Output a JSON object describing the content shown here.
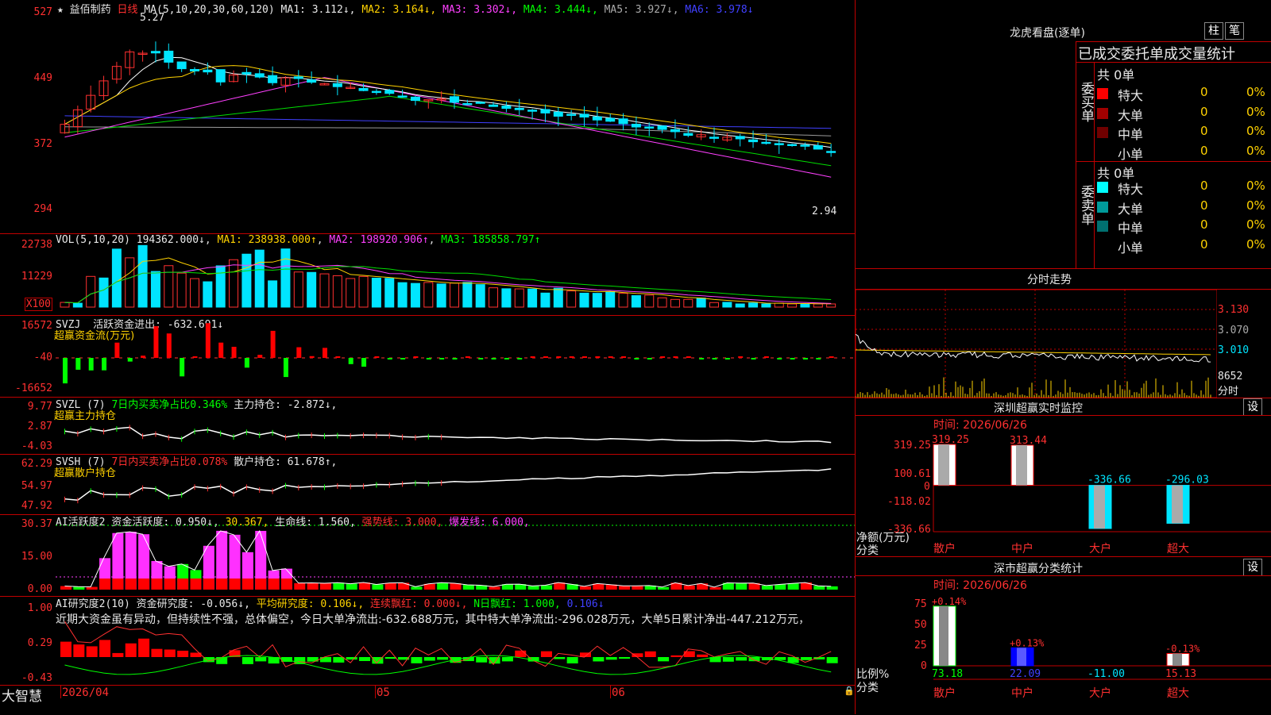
{
  "stock": {
    "name": "益佰制药",
    "period": "日线",
    "brand": "大智慧"
  },
  "colors": {
    "up": "#ff3030",
    "down": "#00e5ff",
    "frame": "#c00000",
    "ma1": "#ffffff",
    "ma2": "#ffd200",
    "ma3": "#ff40ff",
    "ma4": "#00dd00",
    "ma5": "#9a9a9a",
    "ma6": "#4040ff"
  },
  "main_pane": {
    "ma_header": "MA(5,10,20,30,60,120)",
    "ma_values": [
      {
        "label": "MA1:",
        "value": "3.112↓"
      },
      {
        "label": "MA2:",
        "value": "3.164↓"
      },
      {
        "label": "MA3:",
        "value": "3.302↓"
      },
      {
        "label": "MA4:",
        "value": "3.444↓"
      },
      {
        "label": "MA5:",
        "value": "3.927↓"
      },
      {
        "label": "MA6:",
        "value": "3.978↓"
      }
    ],
    "y_ticks": [
      "527",
      "449",
      "372",
      "294"
    ],
    "high_label": "5.27",
    "low_label": "2.94"
  },
  "vol_pane": {
    "header": "VOL(5,10,20)",
    "value": "194362.000↓",
    "ma1": "MA1: 238938.000↑",
    "ma2": "MA2: 198920.906↑",
    "ma3": "MA3: 185858.797↑",
    "y_ticks": [
      "22738",
      "11229",
      "X100"
    ]
  },
  "svzj_pane": {
    "header": "SVZJ",
    "label": "活跃资金进出: -632.691↓",
    "subtitle": "超赢资金流(万元)",
    "y_ticks": [
      "16572",
      "-40",
      "-16652"
    ]
  },
  "svzl_pane": {
    "header": "SVZL (7)",
    "label1": "7日内买卖净占比0.346%",
    "label2": "主力持仓: -2.872↓,",
    "subtitle": "超赢主力持仓",
    "y_ticks": [
      "9.77",
      "2.87",
      "-4.03"
    ]
  },
  "svsh_pane": {
    "header": "SVSH (7)",
    "label1": "7日内买卖净占比0.078%",
    "label2": "散户持仓: 61.678↑,",
    "subtitle": "超赢散户持仓",
    "y_ticks": [
      "62.29",
      "54.97",
      "47.92"
    ]
  },
  "ai1_pane": {
    "header": "AI活跃度2",
    "label1": "资金活跃度: 0.950↓",
    "label2": "30.367,",
    "label3": "生命线: 1.560,",
    "label4": "强势线: 3.000,",
    "label5": "爆发线: 6.000,",
    "y_ticks": [
      "30.37",
      "15.00",
      "0.00"
    ]
  },
  "ai2_pane": {
    "header": "AI研究度2(10)",
    "label1": "资金研究度: -0.056↓,",
    "label2": "平均研究度: 0.106↓,",
    "label3": "连续飘红: 0.000↓,",
    "label4": "N日飘红: 1.000,",
    "label5": "0.106↓",
    "commentary": "近期大资金虽有异动，但持续性不强，总体偏空，今日大单净流出:-632.688万元，其中特大单净流出:-296.028万元，大单5日累计净出-447.212万元，",
    "y_ticks": [
      "1.00",
      "0.29",
      "-0.43"
    ]
  },
  "x_axis": {
    "labels": [
      "2026/04",
      "05",
      "06"
    ]
  },
  "right_panel": {
    "lhb": {
      "title": "龙虎看盘(逐单)",
      "btn_bar": "柱",
      "btn_pen": "笔",
      "table_title": "已成交委托单成交量统计",
      "buy_label": "委买单",
      "sell_label": "委卖单",
      "buy_total": "共 0单",
      "sell_total": "共 0单",
      "buy_rows": [
        {
          "name": "特大",
          "count": "0",
          "pct": "0%",
          "color": "#ff0000"
        },
        {
          "name": "大单",
          "count": "0",
          "pct": "0%",
          "color": "#a00000"
        },
        {
          "name": "中单",
          "count": "0",
          "pct": "0%",
          "color": "#700000"
        },
        {
          "name": "小单",
          "count": "0",
          "pct": "0%",
          "color": ""
        }
      ],
      "sell_rows": [
        {
          "name": "特大",
          "count": "0",
          "pct": "0%",
          "color": "#00ffff"
        },
        {
          "name": "大单",
          "count": "0",
          "pct": "0%",
          "color": "#009a9a"
        },
        {
          "name": "中单",
          "count": "0",
          "pct": "0%",
          "color": "#007070"
        },
        {
          "name": "小单",
          "count": "0",
          "pct": "0%",
          "color": ""
        }
      ]
    },
    "intraday": {
      "title": "分时走势",
      "y_ticks": [
        "3.130",
        "3.070",
        "3.010",
        "8652"
      ],
      "vol_label": "分时"
    },
    "monitor": {
      "title": "深圳超赢实时监控",
      "btn": "设",
      "time": "时间: 2026/06/26",
      "y_ticks": [
        "319.25",
        "100.61",
        "0",
        "-118.02",
        "-336.66"
      ],
      "y_title": "净额(万元)",
      "x_title": "分类",
      "chart_data": {
        "type": "bar",
        "categories": [
          "散户",
          "中户",
          "大户",
          "超大"
        ],
        "values": [
          319.25,
          313.44,
          -336.66,
          -296.03
        ],
        "value_labels": [
          "319.25",
          "313.44",
          "-336.66",
          "-296.03"
        ],
        "ylim": [
          -336.66,
          319.25
        ],
        "ylabel": "净额(万元)",
        "xlabel": "分类"
      }
    },
    "classify": {
      "title": "深市超赢分类统计",
      "btn": "设",
      "time": "时间: 2026/06/26",
      "y_ticks": [
        "75",
        "50",
        "25",
        "0"
      ],
      "y_title": "比例%",
      "x_title": "分类",
      "chart_data": {
        "type": "bar",
        "categories": [
          "散户",
          "中户",
          "大户",
          "超大"
        ],
        "values": [
          73.18,
          22.09,
          -11.0,
          15.13
        ],
        "value_labels": [
          "73.18",
          "22.09",
          "-11.00",
          "15.13"
        ],
        "change_labels": [
          "+0.14%",
          "+0.13%",
          "",
          "-0.13%"
        ],
        "ylim": [
          0,
          75
        ],
        "ylabel": "比例%",
        "xlabel": "分类"
      }
    }
  }
}
